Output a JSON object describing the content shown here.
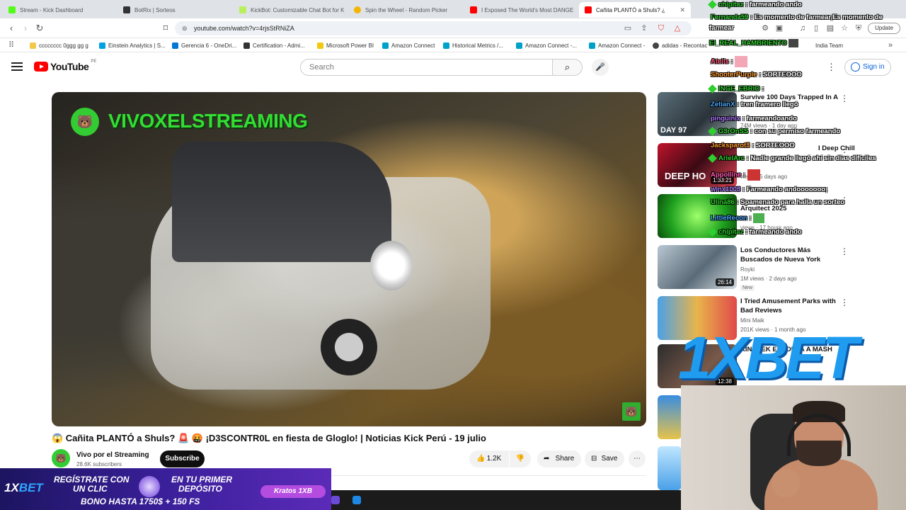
{
  "browser": {
    "tabs": [
      {
        "title": "Stream - Kick Dashboard",
        "color": "#53fc18",
        "active": false
      },
      {
        "title": "BotRix | Sorteos",
        "color": "#333333",
        "active": false
      },
      {
        "title": "KickBot: Customizable Chat Bot for K",
        "color": "#b7f05a",
        "active": false
      },
      {
        "title": "Spin the Wheel - Random Picker",
        "color": "#f4b400",
        "active": false
      },
      {
        "title": "I Exposed The World's Most DANGE",
        "color": "#ff0000",
        "active": false
      },
      {
        "title": "Cañita PLANTÓ a Shuls? ¿",
        "color": "#ff0000",
        "active": true
      }
    ],
    "url": "youtube.com/watch?v=4rjsStRNiZA",
    "update_label": "Update",
    "bookmarks": [
      {
        "label": "cccccccc 0ggg gg g",
        "color": "#f2c94c"
      },
      {
        "label": "Einstein Analytics | S...",
        "color": "#00a1e0"
      },
      {
        "label": "Gerencia 6 - OneDri...",
        "color": "#0078d4"
      },
      {
        "label": "Certification - Admi...",
        "color": "#333333"
      },
      {
        "label": "Microsoft Power BI",
        "color": "#f2c811"
      },
      {
        "label": "Amazon Connect",
        "color": "#00a1c9"
      },
      {
        "label": "Historical Metrics /...",
        "color": "#00a1c9"
      },
      {
        "label": "Amazon Connect -...",
        "color": "#00a1c9"
      },
      {
        "label": "Amazon Connect -",
        "color": "#00a1c9"
      },
      {
        "label": "adidas - Recontac",
        "color": "#444444"
      },
      {
        "label": "India Team",
        "color": "#888888"
      }
    ]
  },
  "youtube": {
    "logo_text": "YouTube",
    "country_code": "PE",
    "search_placeholder": "Search",
    "signin_label": "Sign in",
    "video": {
      "watermark": "VIVOXELSTREAMING",
      "title": "😱 Cañita PLANTÓ a Shuls? 🚨 🤬 ¡D3SCONTR0L en fiesta de Gloglo! | Noticias Kick Perú - 19 julio",
      "channel_name": "Vivo por el Streaming",
      "subscribers": "28.6K subscribers",
      "subscribe_label": "Subscribe",
      "likes": "1.2K",
      "share_label": "Share",
      "save_label": "Save"
    },
    "recommendations": [
      {
        "title": "Survive 100 Days Trapped In A",
        "channel": "",
        "meta": "74M views · 1 day ago",
        "duration": "",
        "badge": ""
      },
      {
        "title": "I Deep Chill",
        "channel": "",
        "meta": "views · 5 days ago",
        "duration": "1:33:21",
        "badge": ""
      },
      {
        "title": "Arquitect 2025",
        "channel": "",
        "meta": "views · 17 hours ago",
        "duration": "",
        "badge": ""
      },
      {
        "title": "Los Conductores Más Buscados de Nueva York",
        "channel": "Royki",
        "meta": "1M views · 2 days ago",
        "duration": "26:14",
        "badge": "New"
      },
      {
        "title": "I Tried Amusement Parks with Bad Reviews",
        "channel": "Mini Maik",
        "meta": "201K views · 1 month ago",
        "duration": "",
        "badge": ""
      },
      {
        "title": "KINGTEK ESPONJA A MASH",
        "channel": "",
        "meta": "",
        "duration": "12:38",
        "badge": ""
      }
    ]
  },
  "chat": [
    {
      "user": "chipitaz",
      "msg": "farmeando ando",
      "color": "#2fcf2f"
    },
    {
      "user": "Fernanda59",
      "msg": "Es momento de farmear,Es momento de",
      "color": "#2fcf2f"
    },
    {
      "user": "",
      "msg": "farmear",
      "color": "#ffffff"
    },
    {
      "user": "El_REAL_HAMBRIENTO",
      "msg": "",
      "color": "#2fcf2f"
    },
    {
      "user": "Atelis",
      "msg": "",
      "color": "#ff5b7a"
    },
    {
      "user": "ShooterPurple",
      "msg": "SORTEOOO",
      "color": "#ff9a2f"
    },
    {
      "user": "INGE_EBRIO",
      "msg": "",
      "color": "#2fcf2f"
    },
    {
      "user": "ZetianX",
      "msg": "tren framero llegó",
      "color": "#4aa8ff"
    },
    {
      "user": "pinguinix",
      "msg": "farmeandoando",
      "color": "#b07cff"
    },
    {
      "user": "G3rOnSS",
      "msg": "con su permiso farmeando",
      "color": "#2fcf2f"
    },
    {
      "user": "Jacksparot3",
      "msg": "SORTEOOO",
      "color": "#ff9a2f"
    },
    {
      "user": "ArielArc",
      "msg": "Nadie grande llegó ahí sin días difíciles",
      "color": "#2fcf2f"
    },
    {
      "user": "Appolline",
      "msg": "",
      "color": "#ff5bb0"
    },
    {
      "user": "winx1003",
      "msg": "Farmeando andooooooo;",
      "color": "#b07cff"
    },
    {
      "user": "Ulina86",
      "msg": "Spamenado para halla un sorteo",
      "color": "#2fcf2f"
    },
    {
      "user": "LittleRecon",
      "msg": "",
      "color": "#4aa8ff"
    },
    {
      "user": "chipitaz",
      "msg": "farmeando ando",
      "color": "#2fcf2f"
    }
  ],
  "ads": {
    "brand_prefix": "1X",
    "brand_suffix": "BET",
    "line1": "REGÍSTRATE CON",
    "line2": "UN CLIC",
    "line3": "EN TU PRIMER",
    "line4": "DEPÓSITO",
    "line5": "BONO HASTA 1750$ + 150 FS",
    "pill": "Kratos 1XB",
    "big_logo": "1XBET"
  }
}
